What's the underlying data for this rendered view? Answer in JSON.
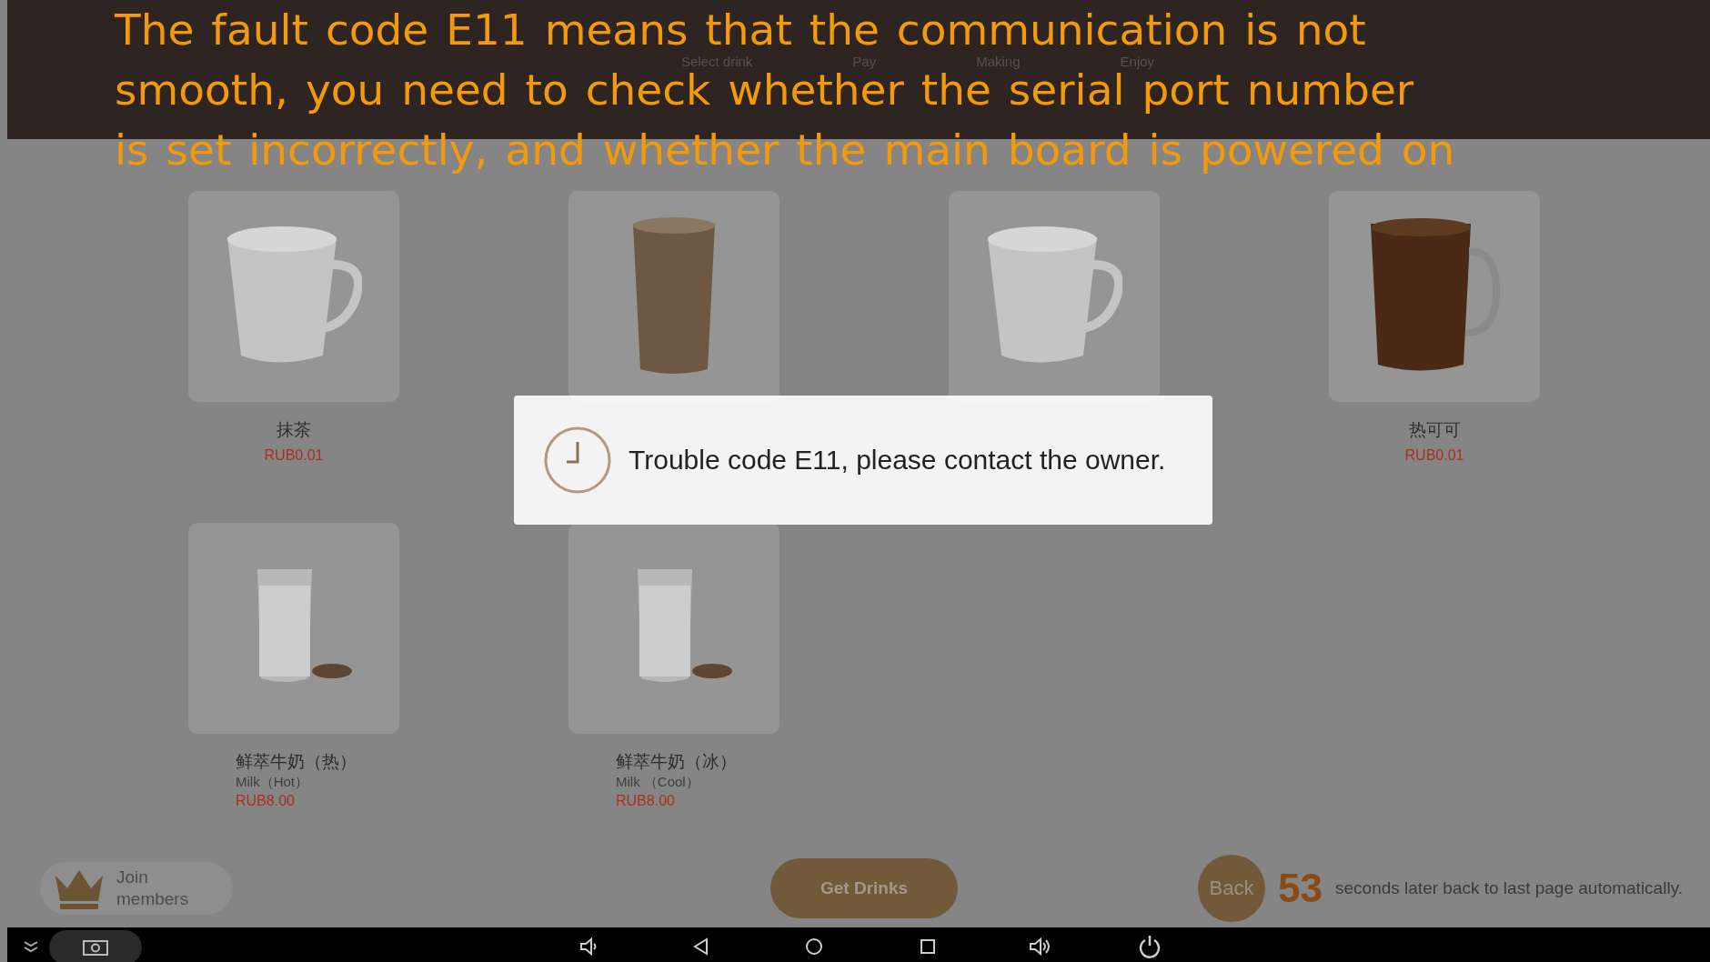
{
  "annotation_lines": [
    "The fault code E11 means that the communication is not",
    "smooth, you need to check whether the serial port number",
    "is set incorrectly, and whether the main board is powered on"
  ],
  "steps": [
    {
      "label": "Select drink"
    },
    {
      "label": "Pay"
    },
    {
      "label": "Making"
    },
    {
      "label": "Enjoy"
    }
  ],
  "products": [
    {
      "kind": "mug",
      "name": "抹茶",
      "price": "RUB0.01"
    },
    {
      "kind": "cup"
    },
    {
      "kind": "mug"
    },
    {
      "kind": "cocoa",
      "name": "热可可",
      "price": "RUB0.01"
    },
    {
      "kind": "glass",
      "name": "鲜萃牛奶（热）",
      "subtitle": "Milk（Hot）",
      "price": "RUB8.00"
    },
    {
      "kind": "glass",
      "name": "鲜萃牛奶（冰）",
      "subtitle": "Milk （Cool）",
      "price": "RUB8.00"
    }
  ],
  "dialog": {
    "message": "Trouble code E11, please contact the owner."
  },
  "footer": {
    "join": "Join members",
    "get_drinks": "Get Drinks",
    "back": "Back",
    "countdown": "53",
    "countdown_text": "seconds later back to last page automatically."
  }
}
